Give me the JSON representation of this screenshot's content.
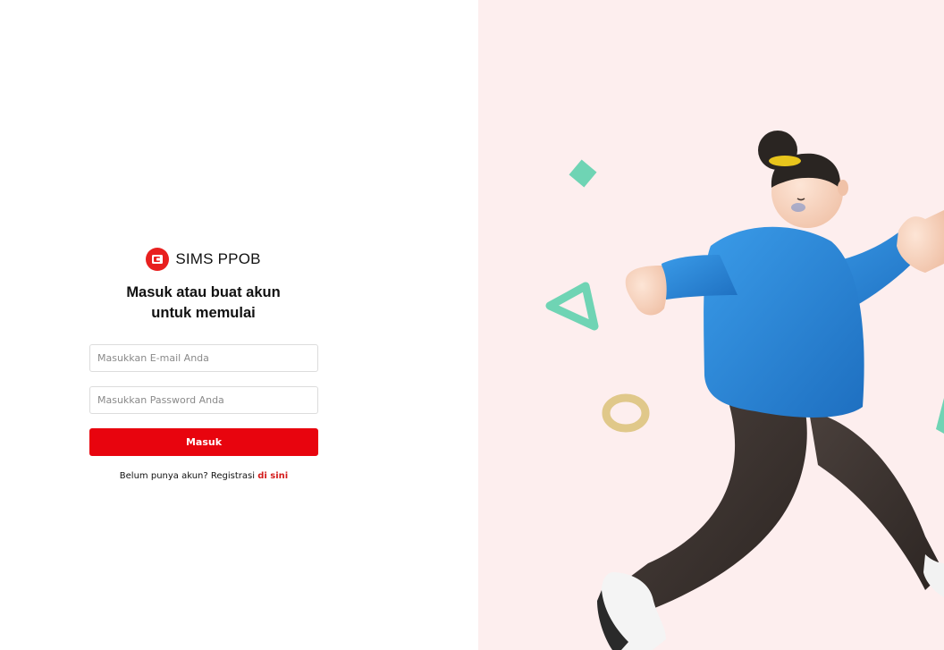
{
  "brand": {
    "name": "SIMS PPOB",
    "accent_color": "#e8201f",
    "logo_icon": "wallet-icon"
  },
  "login": {
    "headline_line1": "Masuk atau buat akun",
    "headline_line2": "untuk memulai",
    "email_placeholder": "Masukkan E-mail Anda",
    "email_value": "",
    "password_placeholder": "Masukkan Password Anda",
    "password_value": "",
    "submit_label": "Masuk",
    "submit_color": "#e8040e",
    "register_prompt": "Belum punya akun? Registrasi ",
    "register_link": "di sini"
  },
  "illustration": {
    "background_color": "#fdeeee",
    "subject": "person-walking-illustration"
  }
}
